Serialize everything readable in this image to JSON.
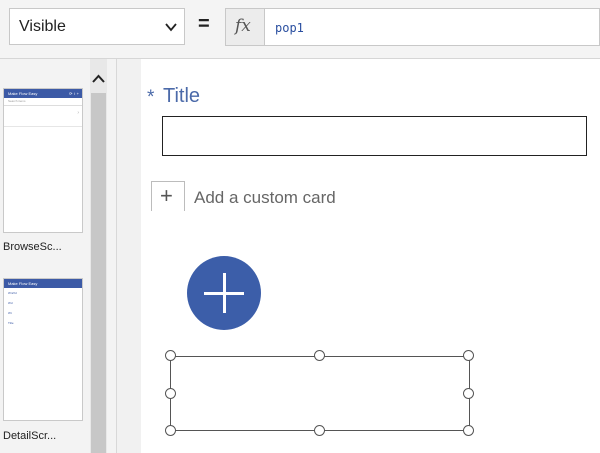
{
  "formula_bar": {
    "property": "Visible",
    "equals": "=",
    "fx_label": "fx",
    "formula": "pop1"
  },
  "screens": [
    {
      "name": "BrowseSc...",
      "thumb_header": "Make Flow Easy",
      "thumb_search": "Search items"
    },
    {
      "name": "DetailScr...",
      "thumb_header": "Make Flow Easy",
      "thumb_lines": [
        "Wnrfid",
        "Wd",
        "Wt",
        "Title"
      ]
    }
  ],
  "canvas": {
    "required_marker": "*",
    "field_label": "Title",
    "title_value": "",
    "add_card_label": "Add a custom card",
    "add_card_icon": "+",
    "fab_icon": "plus-icon"
  },
  "colors": {
    "accent": "#3c5ea9",
    "label_blue": "#4b6aa9"
  }
}
